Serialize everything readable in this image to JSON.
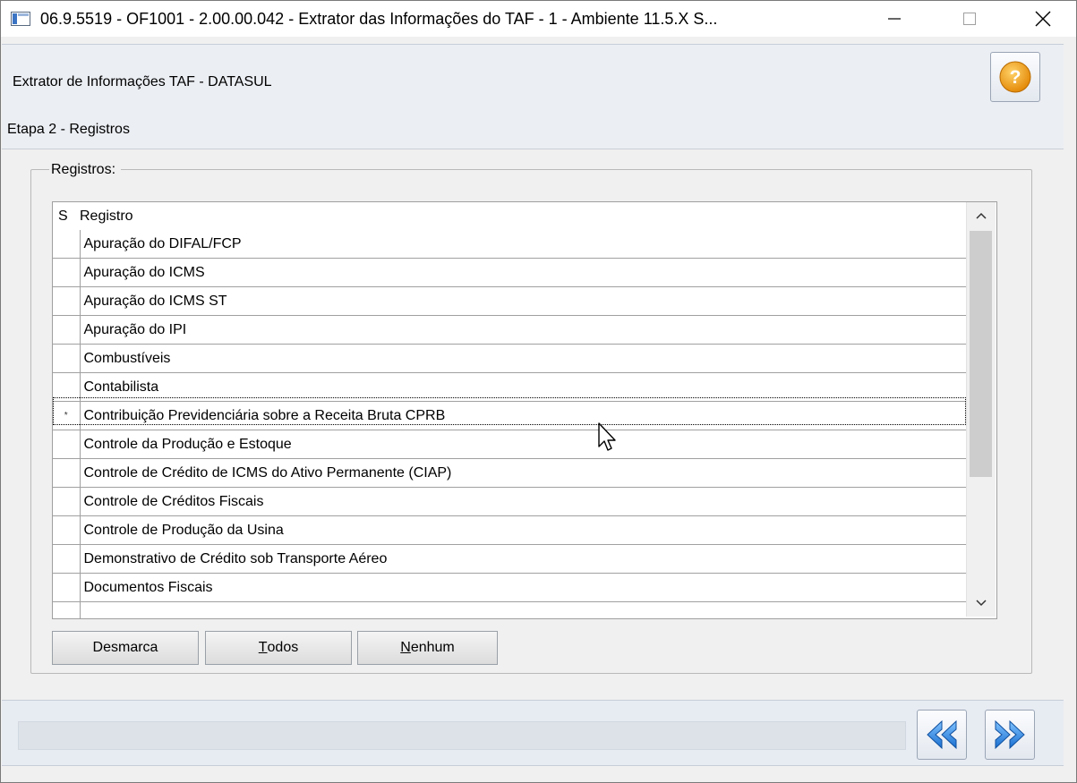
{
  "window": {
    "title": "06.9.5519 - OF1001 - 2.00.00.042 - Extrator das Informações do TAF - 1 - Ambiente 11.5.X S..."
  },
  "header": {
    "title": "Extrator de Informações TAF - DATASUL",
    "help_icon": "help-icon"
  },
  "step": {
    "title": "Etapa 2 - Registros"
  },
  "registros": {
    "legend": "Registros:",
    "columns": [
      "S",
      "Registro"
    ],
    "rows": [
      {
        "s": "",
        "registro": "Apuração do DIFAL/FCP"
      },
      {
        "s": "",
        "registro": "Apuração do ICMS"
      },
      {
        "s": "",
        "registro": "Apuração do ICMS ST"
      },
      {
        "s": "",
        "registro": "Apuração do IPI"
      },
      {
        "s": "",
        "registro": "Combustíveis"
      },
      {
        "s": "",
        "registro": "Contabilista"
      },
      {
        "s": "*",
        "registro": "Contribuição Previdenciária sobre a Receita Bruta  CPRB"
      },
      {
        "s": "",
        "registro": "Controle da Produção e Estoque"
      },
      {
        "s": "",
        "registro": "Controle de Crédito de ICMS do Ativo Permanente (CIAP)"
      },
      {
        "s": "",
        "registro": "Controle de Créditos Fiscais"
      },
      {
        "s": "",
        "registro": "Controle de Produção da Usina"
      },
      {
        "s": "",
        "registro": "Demonstrativo de Crédito sob Transporte Aéreo"
      },
      {
        "s": "",
        "registro": "Documentos Fiscais"
      },
      {
        "s": "",
        "registro": ""
      }
    ]
  },
  "buttons": {
    "desmarca": "Desmarca",
    "todos_first": "T",
    "todos_rest": "odos",
    "nenhum_first": "N",
    "nenhum_rest": "enhum"
  },
  "footer": {
    "status": "",
    "back_icon": "double-left-arrow-icon",
    "next_icon": "double-right-arrow-icon"
  },
  "colors": {
    "accent_blue": "#1e7fd8",
    "help_orange": "#f0a020",
    "panel": "#ebeef3"
  }
}
